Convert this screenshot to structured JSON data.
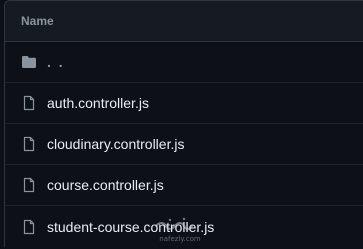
{
  "header": {
    "label": "Name"
  },
  "rows": [
    {
      "icon": "folder-icon",
      "label": ". ."
    },
    {
      "icon": "file-icon",
      "label": "auth.controller.js"
    },
    {
      "icon": "file-icon",
      "label": "cloudinary.controller.js"
    },
    {
      "icon": "file-icon",
      "label": "course.controller.js"
    },
    {
      "icon": "file-icon",
      "label": "student-course.controller.js"
    }
  ],
  "watermark": {
    "text": "nafezly.com"
  },
  "colors": {
    "background": "#0d1117",
    "header_bg": "#161b22",
    "border": "#30363d",
    "text": "#e6edf3",
    "muted": "#8b949e"
  }
}
